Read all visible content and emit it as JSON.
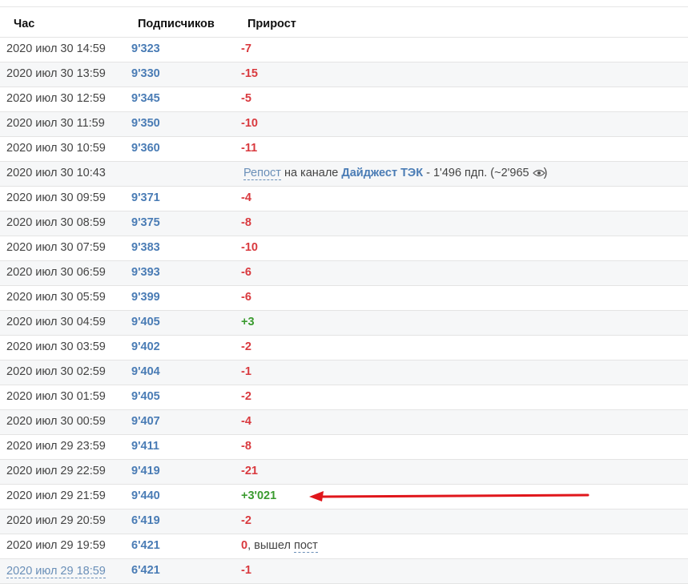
{
  "header": {
    "hour": "Час",
    "subscribers": "Подписчиков",
    "growth": "Прирост"
  },
  "rows": [
    {
      "time": "2020 июл 30 14:59",
      "subs": "9'323",
      "growth": "-7",
      "kind": "neg"
    },
    {
      "time": "2020 июл 30 13:59",
      "subs": "9'330",
      "growth": "-15",
      "kind": "neg"
    },
    {
      "time": "2020 июл 30 12:59",
      "subs": "9'345",
      "growth": "-5",
      "kind": "neg"
    },
    {
      "time": "2020 июл 30 11:59",
      "subs": "9'350",
      "growth": "-10",
      "kind": "neg"
    },
    {
      "time": "2020 июл 30 10:59",
      "subs": "9'360",
      "growth": "-11",
      "kind": "neg"
    },
    {
      "time": "2020 июл 30 10:43",
      "repost": {
        "link": "Репост",
        "on_channel": "на канале",
        "channel": "Дайджест ТЭК",
        "details": "- 1'496 пдп. (~2'965",
        "close": ")"
      }
    },
    {
      "time": "2020 июл 30 09:59",
      "subs": "9'371",
      "growth": "-4",
      "kind": "neg"
    },
    {
      "time": "2020 июл 30 08:59",
      "subs": "9'375",
      "growth": "-8",
      "kind": "neg"
    },
    {
      "time": "2020 июл 30 07:59",
      "subs": "9'383",
      "growth": "-10",
      "kind": "neg"
    },
    {
      "time": "2020 июл 30 06:59",
      "subs": "9'393",
      "growth": "-6",
      "kind": "neg"
    },
    {
      "time": "2020 июл 30 05:59",
      "subs": "9'399",
      "growth": "-6",
      "kind": "neg"
    },
    {
      "time": "2020 июл 30 04:59",
      "subs": "9'405",
      "growth": "+3",
      "kind": "pos"
    },
    {
      "time": "2020 июл 30 03:59",
      "subs": "9'402",
      "growth": "-2",
      "kind": "neg"
    },
    {
      "time": "2020 июл 30 02:59",
      "subs": "9'404",
      "growth": "-1",
      "kind": "neg"
    },
    {
      "time": "2020 июл 30 01:59",
      "subs": "9'405",
      "growth": "-2",
      "kind": "neg"
    },
    {
      "time": "2020 июл 30 00:59",
      "subs": "9'407",
      "growth": "-4",
      "kind": "neg"
    },
    {
      "time": "2020 июл 29 23:59",
      "subs": "9'411",
      "growth": "-8",
      "kind": "neg"
    },
    {
      "time": "2020 июл 29 22:59",
      "subs": "9'419",
      "growth": "-21",
      "kind": "neg"
    },
    {
      "time": "2020 июл 29 21:59",
      "subs": "9'440",
      "growth": "+3'021",
      "kind": "pos",
      "highlight": true
    },
    {
      "time": "2020 июл 29 20:59",
      "subs": "6'419",
      "growth": "-2",
      "kind": "neg"
    },
    {
      "time": "2020 июл 29 19:59",
      "subs": "6'421",
      "growth": "0",
      "kind": "neg",
      "suffix": ", вышел",
      "post_link": "пост"
    },
    {
      "time": "2020 июл 29 18:59",
      "subs": "6'421",
      "growth": "-1",
      "kind": "neg",
      "time_link": true
    }
  ],
  "colors": {
    "negative": "#d9393e",
    "positive": "#3a9b2f",
    "link": "#4a7cb5",
    "arrow": "#e0161b"
  },
  "icons": {
    "views": "eye-icon",
    "annotation": "red-arrow"
  }
}
